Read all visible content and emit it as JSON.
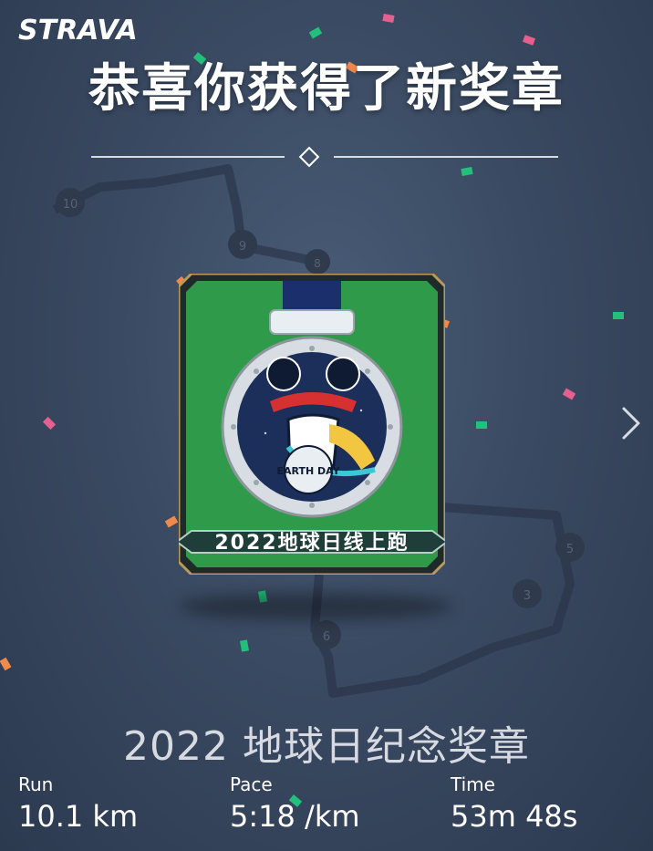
{
  "app": {
    "logo": "STRAVA"
  },
  "header": {
    "headline": "恭喜你获得了新奖章"
  },
  "badge": {
    "ribbon_text": "2022地球日线上跑",
    "medal_text": "EARTH DAY",
    "title": "2022 地球日纪念奖章"
  },
  "map": {
    "markers": [
      "10",
      "9",
      "8",
      "6",
      "5",
      "3"
    ]
  },
  "stats": [
    {
      "label": "Run",
      "value": "10.1 km"
    },
    {
      "label": "Pace",
      "value": "5:18 /km"
    },
    {
      "label": "Time",
      "value": "53m 48s"
    }
  ],
  "colors": {
    "background": "#3a4a62",
    "badge_green": "#2e9a4a",
    "confetti_pink": "#e5608f",
    "confetti_green": "#22c07a",
    "confetti_orange": "#f08a4b"
  },
  "icons": {
    "next": "chevron-right-icon",
    "divider": "diamond-icon"
  }
}
